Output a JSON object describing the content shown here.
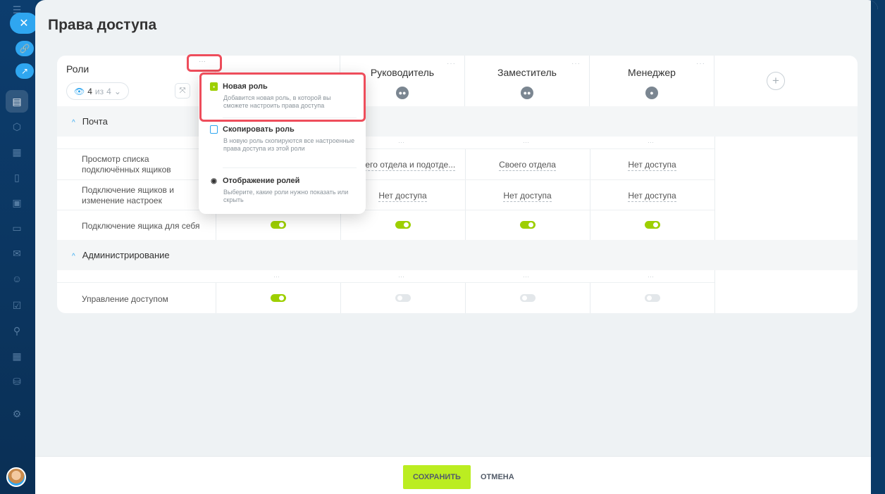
{
  "page": {
    "title": "Права доступа"
  },
  "roles_header": {
    "title": "Роли",
    "counter_current": "4",
    "counter_of": "из",
    "counter_total": "4"
  },
  "roles": [
    {
      "name": "Руководитель",
      "icon": "group-icon"
    },
    {
      "name": "Заместитель",
      "icon": "group-icon"
    },
    {
      "name": "Менеджер",
      "icon": "user-icon"
    }
  ],
  "sections": [
    {
      "title": "Почта",
      "rows": [
        {
          "label": "Просмотр списка подключённых ящиков",
          "values": [
            "",
            "Своего отдела и подотде...",
            "Своего отдела",
            "Нет доступа"
          ]
        },
        {
          "label": "Подключение ящиков и изменение настроек",
          "values": [
            "",
            "Нет доступа",
            "Нет доступа",
            "Нет доступа"
          ]
        },
        {
          "label": "Подключение ящика для себя",
          "toggles": [
            true,
            true,
            true,
            true
          ]
        }
      ]
    },
    {
      "title": "Администрирование",
      "rows": [
        {
          "label": "Управление доступом",
          "toggles": [
            true,
            false,
            false,
            false
          ]
        }
      ]
    }
  ],
  "dropdown": {
    "items": [
      {
        "title": "Новая роль",
        "desc": "Добавится новая роль, в которой вы сможете настроить права доступа",
        "icon": "new-role-icon",
        "color": "#9dcf00"
      },
      {
        "title": "Скопировать роль",
        "desc": "В новую роль скопируются все настроенные права доступа из этой роли",
        "icon": "copy-icon",
        "color": "#2fa6f0"
      },
      {
        "title": "Отображение ролей",
        "desc": "Выберите, какие роли нужно показать или скрыть",
        "icon": "eye-icon",
        "color": "#333333"
      }
    ]
  },
  "footer": {
    "save_label": "СОХРАНИТЬ",
    "cancel_label": "ОТМЕНА"
  },
  "colors": {
    "accent": "#2fa6f0",
    "save": "#bbed21",
    "toggle_on": "#9dcf00",
    "highlight": "#ee4d5b"
  }
}
